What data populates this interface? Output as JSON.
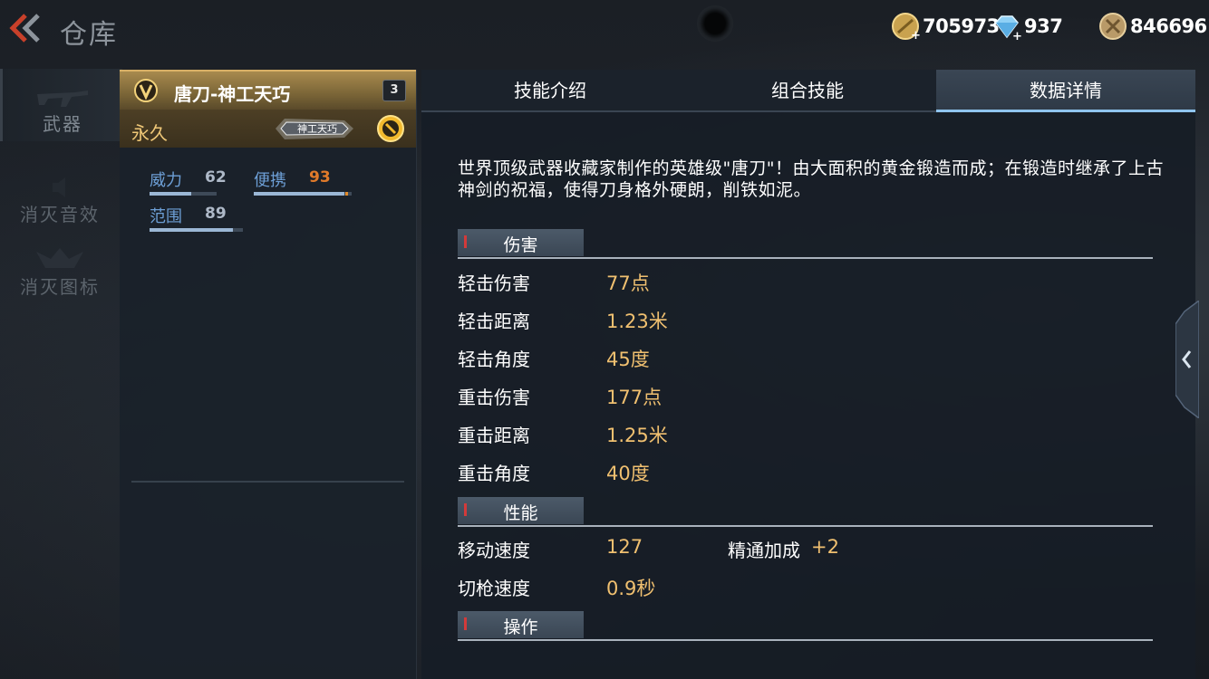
{
  "header": {
    "title": "仓库",
    "currencies": [
      {
        "icon": "gold-coin-icon",
        "value": "705973"
      },
      {
        "icon": "diamond-icon",
        "value": "937"
      },
      {
        "icon": "token-coin-icon",
        "value": "846696"
      }
    ]
  },
  "left_nav": {
    "items": [
      {
        "label": "武器",
        "icon": "rifle-icon",
        "active": true
      },
      {
        "label": "消灭音效",
        "icon": "sound-icon",
        "active": false
      },
      {
        "label": "消灭图标",
        "icon": "skull-emblem-icon",
        "active": false
      }
    ]
  },
  "weapon": {
    "name": "唐刀-神工天巧",
    "level": "3",
    "duration": "永久",
    "title_badge": "神工天巧",
    "stats": [
      {
        "name": "威力",
        "value": "62",
        "fraction": 0.62
      },
      {
        "name": "便携",
        "value": "93",
        "fraction": 0.93
      },
      {
        "name": "范围",
        "value": "89",
        "fraction": 0.89
      }
    ]
  },
  "tabs": [
    {
      "label": "技能介绍",
      "active": false
    },
    {
      "label": "组合技能",
      "active": false
    },
    {
      "label": "数据详情",
      "active": true
    }
  ],
  "detail": {
    "description": "世界顶级武器收藏家制作的英雄级\"唐刀\"！由大面积的黄金锻造而成；在锻造时继承了上古神剑的祝福，使得刀身格外硬朗，削铁如泥。",
    "sections": [
      {
        "label": "伤害",
        "rows": [
          {
            "key": "轻击伤害",
            "value": "77点"
          },
          {
            "key": "轻击距离",
            "value": "1.23米"
          },
          {
            "key": "轻击角度",
            "value": "45度"
          },
          {
            "key": "重击伤害",
            "value": "177点"
          },
          {
            "key": "重击距离",
            "value": "1.25米"
          },
          {
            "key": "重击角度",
            "value": "40度"
          }
        ]
      },
      {
        "label": "性能",
        "rows": [
          {
            "key": "移动速度",
            "value": "127",
            "extra_key": "精通加成",
            "extra_value": "+2"
          },
          {
            "key": "切枪速度",
            "value": "0.9秒"
          }
        ]
      },
      {
        "label": "操作",
        "rows": []
      }
    ]
  },
  "colors": {
    "accent_gold": "#f0c070",
    "stat_label_blue": "#6d9fd6",
    "active_tab_underline": "#8fc4ee",
    "portable_value_orange": "#e07a2a"
  }
}
